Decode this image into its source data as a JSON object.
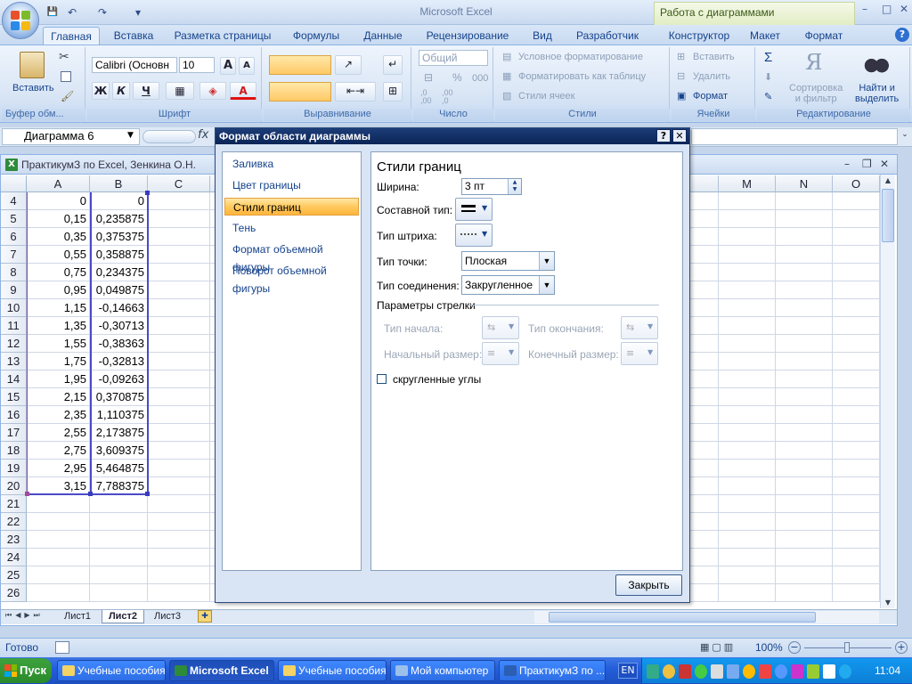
{
  "window": {
    "title": "Microsoft Excel",
    "context_tools": "Работа с диаграммами",
    "controls": [
      "–",
      "□",
      "✕"
    ]
  },
  "qat": {
    "save_icon": "💾",
    "undo_icon": "↶",
    "redo_icon": "↷",
    "more_icon": "▾"
  },
  "tabs": [
    {
      "label": "Главная",
      "active": true
    },
    {
      "label": "Вставка"
    },
    {
      "label": "Разметка страницы"
    },
    {
      "label": "Формулы"
    },
    {
      "label": "Данные"
    },
    {
      "label": "Рецензирование"
    },
    {
      "label": "Вид"
    },
    {
      "label": "Разработчик"
    },
    {
      "label": "Конструктор"
    },
    {
      "label": "Макет"
    },
    {
      "label": "Формат"
    }
  ],
  "ribbon": {
    "clipboard": {
      "label": "Буфер обм...",
      "paste": "Вставить"
    },
    "font": {
      "label": "Шрифт",
      "name": "Calibri (Основн",
      "size": "10",
      "bold": "Ж",
      "italic": "К",
      "underline": "Ч",
      "grow": "A",
      "shrink": "A",
      "font_color": "A"
    },
    "alignment": {
      "label": "Выравнивание"
    },
    "number": {
      "label": "Число",
      "format": "Общий",
      "percent": "%",
      "thousands": "000",
      "inc_dec": ",0\n,00",
      "dec_dec": ",00\n,0"
    },
    "styles": {
      "label": "Стили",
      "conditional": "Условное форматирование",
      "as_table": "Форматировать как таблицу",
      "cell_styles": "Стили ячеек"
    },
    "cells": {
      "label": "Ячейки",
      "insert": "Вставить",
      "delete": "Удалить",
      "format": "Формат"
    },
    "editing": {
      "label": "Редактирование",
      "sum": "Σ",
      "sort": "Сортировка\nи фильтр",
      "find": "Найти и\nвыделить"
    }
  },
  "formula_bar": {
    "name_box": "Диаграмма 6",
    "fx": "fx",
    "content": ""
  },
  "workbook": {
    "title": "ПрактикумЗ по Excel, Зенкина О.Н.",
    "columns_left": [
      "A",
      "B",
      "C"
    ],
    "columns_right": [
      "M",
      "N",
      "O"
    ],
    "rows": [
      {
        "n": "4",
        "a": "0",
        "b": "0"
      },
      {
        "n": "5",
        "a": "0,15",
        "b": "0,235875"
      },
      {
        "n": "6",
        "a": "0,35",
        "b": "0,375375"
      },
      {
        "n": "7",
        "a": "0,55",
        "b": "0,358875"
      },
      {
        "n": "8",
        "a": "0,75",
        "b": "0,234375"
      },
      {
        "n": "9",
        "a": "0,95",
        "b": "0,049875"
      },
      {
        "n": "10",
        "a": "1,15",
        "b": "-0,14663"
      },
      {
        "n": "11",
        "a": "1,35",
        "b": "-0,30713"
      },
      {
        "n": "12",
        "a": "1,55",
        "b": "-0,38363"
      },
      {
        "n": "13",
        "a": "1,75",
        "b": "-0,32813"
      },
      {
        "n": "14",
        "a": "1,95",
        "b": "-0,09263"
      },
      {
        "n": "15",
        "a": "2,15",
        "b": "0,370875"
      },
      {
        "n": "16",
        "a": "2,35",
        "b": "1,110375"
      },
      {
        "n": "17",
        "a": "2,55",
        "b": "2,173875"
      },
      {
        "n": "18",
        "a": "2,75",
        "b": "3,609375"
      },
      {
        "n": "19",
        "a": "2,95",
        "b": "5,464875"
      },
      {
        "n": "20",
        "a": "3,15",
        "b": "7,788375"
      },
      {
        "n": "21",
        "a": "",
        "b": ""
      },
      {
        "n": "22",
        "a": "",
        "b": ""
      },
      {
        "n": "23",
        "a": "",
        "b": ""
      },
      {
        "n": "24",
        "a": "",
        "b": ""
      },
      {
        "n": "25",
        "a": "",
        "b": ""
      },
      {
        "n": "26",
        "a": "",
        "b": ""
      }
    ],
    "sheets": [
      {
        "label": "Лист1"
      },
      {
        "label": "Лист2",
        "active": true
      },
      {
        "label": "Лист3"
      }
    ]
  },
  "dialog": {
    "title": "Формат области диаграммы",
    "help": "?",
    "close_x": "✕",
    "nav": [
      {
        "label": "Заливка"
      },
      {
        "label": "Цвет границы"
      },
      {
        "label": "Стили границ",
        "selected": true
      },
      {
        "label": "Тень"
      },
      {
        "label": "Формат объемной фигуры"
      },
      {
        "label": "Поворот объемной фигуры"
      }
    ],
    "heading": "Стили границ",
    "width_label": "Ширина:",
    "width_value": "3 пт",
    "compound_label": "Составной тип:",
    "dash_label": "Тип штриха:",
    "cap_label": "Тип точки:",
    "cap_value": "Плоская",
    "join_label": "Тип соединения:",
    "join_value": "Закругленное",
    "arrow_section": "Параметры стрелки",
    "begin_type": "Тип начала:",
    "end_type": "Тип окончания:",
    "begin_size": "Начальный размер:",
    "end_size": "Конечный размер:",
    "rounded": "скругленные углы",
    "rounded_checked": false,
    "close": "Закрыть"
  },
  "status": {
    "ready": "Готово",
    "zoom": "100%"
  },
  "taskbar": {
    "start": "Пуск",
    "items": [
      {
        "label": "Учебные пособия",
        "icon": "folder-icon"
      },
      {
        "label": "Microsoft Excel",
        "icon": "excel-icon",
        "active": true
      },
      {
        "label": "Учебные пособия",
        "icon": "folder-icon"
      },
      {
        "label": "Мой компьютер",
        "icon": "computer-icon"
      },
      {
        "label": "ПрактикумЗ по ...",
        "icon": "word-icon"
      }
    ],
    "lang": "EN",
    "clock": "11:04"
  }
}
